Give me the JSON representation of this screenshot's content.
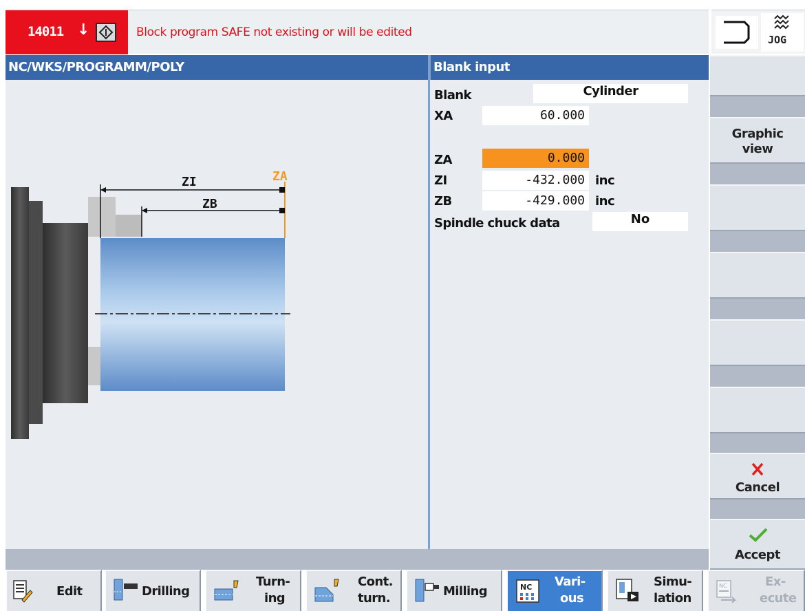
{
  "alarm": {
    "number": "14011",
    "arrow": "↓",
    "message": "Block  program SAFE not existing or will be edited"
  },
  "mode": {
    "label": "JOG",
    "channel_icon": "channel-bracket-icon",
    "mode_icon": "jog-wave-icon"
  },
  "header": {
    "path": "NC/WKS/PROGRAMM/POLY",
    "panel_title": "Blank input"
  },
  "drawing": {
    "labels": {
      "zi": "ZI",
      "zb": "ZB",
      "za": "ZA"
    },
    "colors": {
      "za": "#f29c1f",
      "blank_top": "#cde0f3",
      "blank_bottom": "#5d8cc8"
    }
  },
  "form": {
    "blank": {
      "label": "Blank",
      "value": "Cylinder"
    },
    "xa": {
      "label": "XA",
      "value": "60.000"
    },
    "za": {
      "label": "ZA",
      "value": "0.000",
      "active": true
    },
    "zi": {
      "label": "ZI",
      "value": "-432.000",
      "unit": "inc"
    },
    "zb": {
      "label": "ZB",
      "value": "-429.000",
      "unit": "inc"
    },
    "chuck": {
      "label": "Spindle chuck data",
      "value": "No"
    }
  },
  "vertical_softkeys": {
    "graphic_view": {
      "line1": "Graphic",
      "line2": "view"
    },
    "cancel": {
      "label": "Cancel",
      "icon": "cancel-x-icon",
      "color": "#e0201c"
    },
    "accept": {
      "label": "Accept",
      "icon": "accept-check-icon",
      "color": "#4caf30"
    }
  },
  "horizontal_softkeys": [
    {
      "line1": "Edit",
      "line2": ""
    },
    {
      "line1": "Drilling",
      "line2": ""
    },
    {
      "line1": "Turn-",
      "line2": "ing"
    },
    {
      "line1": "Cont.",
      "line2": "turn."
    },
    {
      "line1": "Milling",
      "line2": ""
    },
    {
      "line1": "Vari-",
      "line2": "ous",
      "active": true
    },
    {
      "line1": "Simu-",
      "line2": "lation"
    },
    {
      "line1": "Ex-",
      "line2": "ecute",
      "disabled": true
    }
  ]
}
